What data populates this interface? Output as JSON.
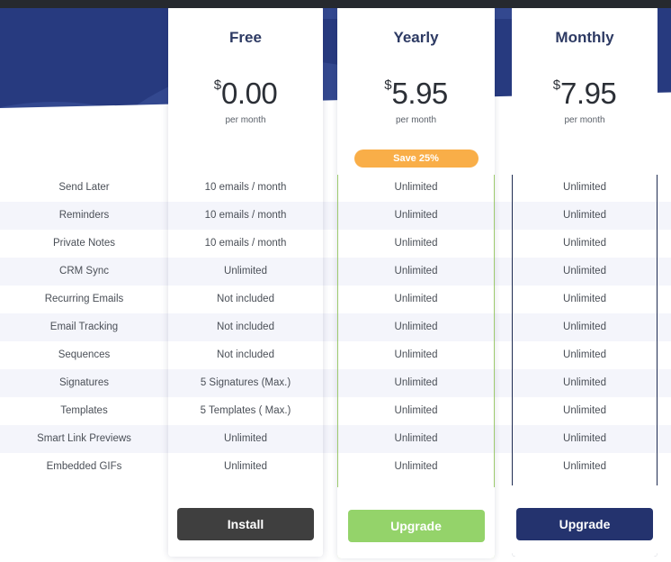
{
  "theme": {
    "banner_color": "#273a7f",
    "banner_accent_color": "#33488f",
    "topbar_color": "#26292f",
    "stripe_color": "#f4f5fb",
    "heading_color": "#2d3a63",
    "badge_color": "#f9ae48",
    "yearly_border_color": "#9ecb6e",
    "monthly_border_color": "#1f2c52",
    "install_button_color": "#3f3f3f",
    "yearly_button_color": "#94d36a",
    "monthly_button_color": "#24336e"
  },
  "plans": [
    {
      "name": "Free",
      "currency": "$",
      "price": "0.00",
      "period": "per month",
      "badge": null,
      "cta": "Install"
    },
    {
      "name": "Yearly",
      "currency": "$",
      "price": "5.95",
      "period": "per month",
      "badge": "Save 25%",
      "cta": "Upgrade"
    },
    {
      "name": "Monthly",
      "currency": "$",
      "price": "7.95",
      "period": "per month",
      "badge": null,
      "cta": "Upgrade"
    }
  ],
  "features": [
    {
      "label": "Send Later",
      "values": [
        "10 emails / month",
        "Unlimited",
        "Unlimited"
      ]
    },
    {
      "label": "Reminders",
      "values": [
        "10 emails / month",
        "Unlimited",
        "Unlimited"
      ]
    },
    {
      "label": "Private Notes",
      "values": [
        "10 emails / month",
        "Unlimited",
        "Unlimited"
      ]
    },
    {
      "label": "CRM Sync",
      "values": [
        "Unlimited",
        "Unlimited",
        "Unlimited"
      ]
    },
    {
      "label": "Recurring Emails",
      "values": [
        "Not included",
        "Unlimited",
        "Unlimited"
      ]
    },
    {
      "label": "Email Tracking",
      "values": [
        "Not included",
        "Unlimited",
        "Unlimited"
      ]
    },
    {
      "label": "Sequences",
      "values": [
        "Not included",
        "Unlimited",
        "Unlimited"
      ]
    },
    {
      "label": "Signatures",
      "values": [
        "5 Signatures (Max.)",
        "Unlimited",
        "Unlimited"
      ]
    },
    {
      "label": "Templates",
      "values": [
        "5 Templates ( Max.)",
        "Unlimited",
        "Unlimited"
      ]
    },
    {
      "label": "Smart Link Previews",
      "values": [
        "Unlimited",
        "Unlimited",
        "Unlimited"
      ]
    },
    {
      "label": "Embedded GIFs",
      "values": [
        "Unlimited",
        "Unlimited",
        "Unlimited"
      ]
    }
  ]
}
